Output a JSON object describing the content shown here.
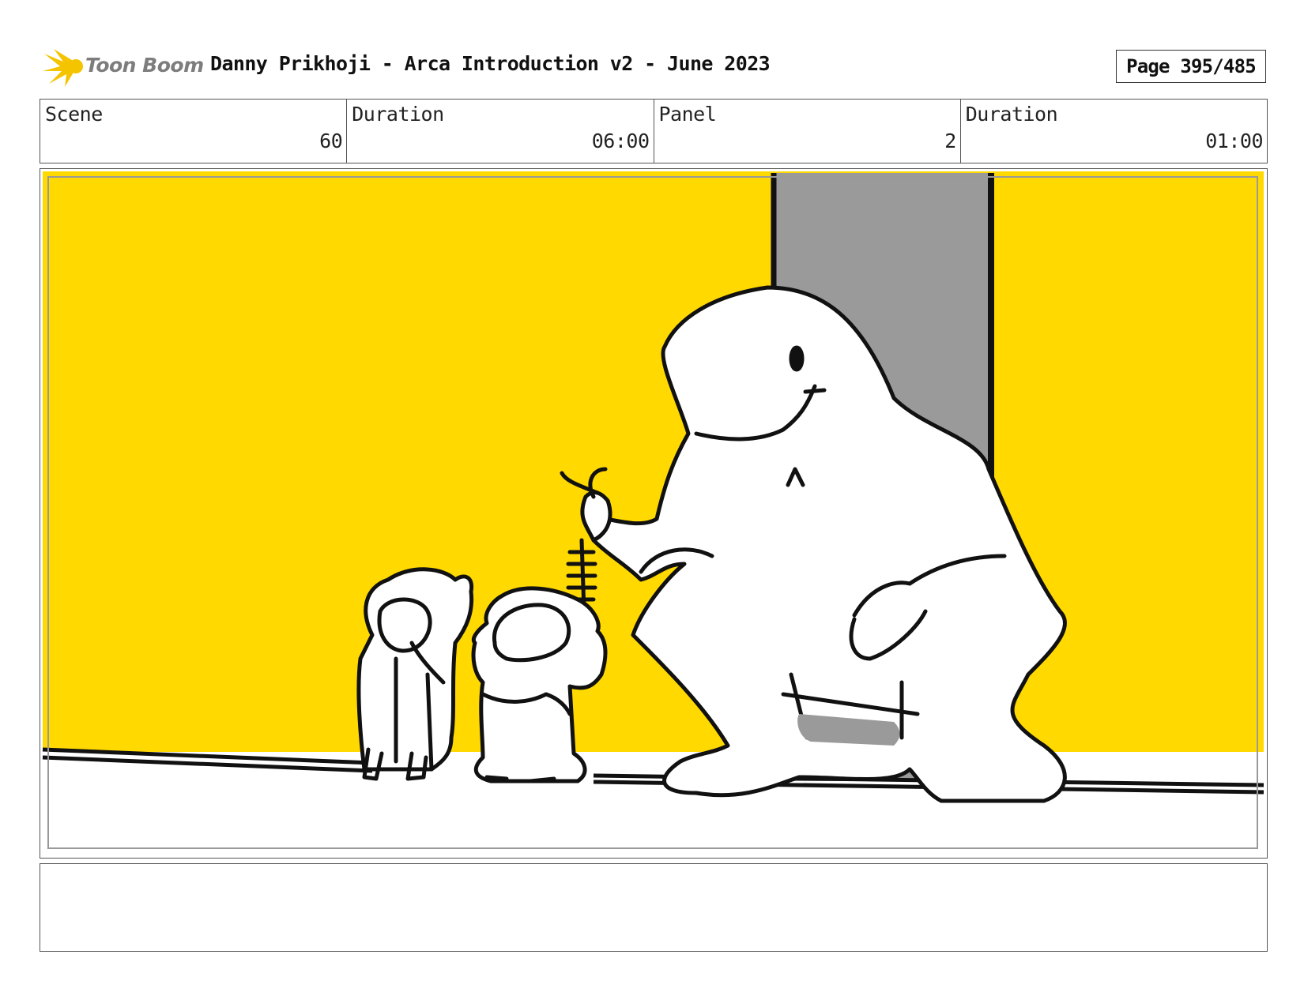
{
  "header": {
    "logo_text": "Toon Boom",
    "title": "Danny Prikhoji - Arca Introduction v2 - June 2023",
    "page_label": "Page 395/485"
  },
  "info": {
    "scene_label": "Scene",
    "scene_value": "60",
    "scene_duration_label": "Duration",
    "scene_duration_value": "06:00",
    "panel_label": "Panel",
    "panel_value": "2",
    "panel_duration_label": "Duration",
    "panel_duration_value": "01:00"
  },
  "notes": {
    "text": ""
  },
  "colors": {
    "wall": "#ffd900",
    "doorway": "#9a9a9a",
    "floor": "#ffffff",
    "ink": "#111111",
    "logo_yellow": "#f5c400",
    "logo_text": "#7d7d7d"
  }
}
